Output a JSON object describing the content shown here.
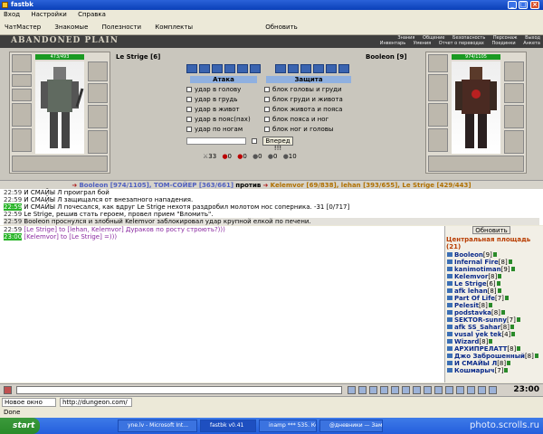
{
  "window": {
    "title": "fastbk",
    "minimize": "_",
    "maximize": "□",
    "close": "×"
  },
  "menu": [
    "Вход",
    "Настройки",
    "Справка"
  ],
  "toolbar": [
    "ЧатМастер",
    "Знакомые",
    "Полезности",
    "Комплекты",
    "Обновить"
  ],
  "game": {
    "logo": "ABANDONED PLAIN",
    "nav_row1": [
      "Знания",
      "Общение",
      "Безопасность",
      "Персонаж",
      "Выход"
    ],
    "nav_row2": [
      "Инвентарь",
      "Умения",
      "Отчет о переводах",
      "Поединки",
      "Анкета"
    ],
    "left_player": {
      "name": "Le Strige",
      "level": "[6]",
      "hp": "473/493"
    },
    "right_player": {
      "name": "Booleon",
      "level": "[9]",
      "hp": "974/1105"
    },
    "attack_header": "Атака",
    "defense_header": "Защита",
    "attack_options": [
      "удар в голову",
      "удар в грудь",
      "удар в живот",
      "удар в пояс(пах)",
      "удар по ногам"
    ],
    "defense_options": [
      "блок головы и груди",
      "блок груди и живота",
      "блок живота и пояса",
      "блок пояса и ног",
      "блок ног и головы"
    ],
    "forward_button": "Вперед !!!",
    "stat_icons": [
      "33",
      "0",
      "0",
      "0",
      "0",
      "10"
    ]
  },
  "vs_bar": {
    "team1": "Booleon [974/1105], ТОМ-СОЙЕР [363/661]",
    "vs": "против",
    "team2": "Kelemvor [69/838], lehan [393/655], Le Strige [429/443]"
  },
  "battle_log": [
    {
      "time": "22:59",
      "text": "И СМАЙЫ Л проиграл бой"
    },
    {
      "time": "22:59",
      "text": "И СМАЙЫ Л защищался от внезапного нападения."
    },
    {
      "time": "22:59",
      "text": "И СМАЙЫ Л почесался, как вдруг Le Strige нехотя раздробил молотом нос соперника. -31 [0/717]"
    },
    {
      "time": "22:59",
      "text": "Le Strige, решив стать героем, провел прием \"Вломить\"."
    },
    {
      "time": "22:59",
      "text": "Booleon проснулся и злобный Kelemvor заблокировал удар крупной елкой по печени."
    }
  ],
  "chat": [
    {
      "time": "22:59",
      "text": "[Le Strige] to [lehan, Kelemvor] Дураков по росту строють?)))"
    },
    {
      "time": "23:00",
      "text": "[Kelemvor] to [Le Strige] =)))"
    }
  ],
  "online": {
    "refresh": "Обновить",
    "location": "Центральная площадь",
    "count": "(21)",
    "users": [
      {
        "name": "Booleon",
        "level": "[9]"
      },
      {
        "name": "Infernal Fire",
        "level": "[8]"
      },
      {
        "name": "kanimotiman",
        "level": "[9]"
      },
      {
        "name": "Kelemvor",
        "level": "[8]"
      },
      {
        "name": "Le Strige",
        "level": "[6]"
      },
      {
        "name": "afk lehan",
        "level": "[8]"
      },
      {
        "name": "Part Of Life",
        "level": "[7]"
      },
      {
        "name": "Pelesit",
        "level": "[8]"
      },
      {
        "name": "podstavka",
        "level": "[8]"
      },
      {
        "name": "SEKTOR-sunny",
        "level": "[7]"
      },
      {
        "name": "afk SS_Sahar",
        "level": "[8]"
      },
      {
        "name": "vusal yek tek",
        "level": "[4]"
      },
      {
        "name": "Wizard",
        "level": "[8]"
      },
      {
        "name": "АРХИПРЕЛАТТ",
        "level": "[8]"
      },
      {
        "name": "Джо Заброшенный",
        "level": "[8]"
      },
      {
        "name": "И СМАЙЫ Л",
        "level": "[8]"
      },
      {
        "name": "Кошмарыч",
        "level": "[7]"
      }
    ]
  },
  "clock": "23:00",
  "status": {
    "new_window": "Новое окно",
    "url": "http://dungeon.com/",
    "done": "Done"
  },
  "taskbar": {
    "start": "start",
    "tasks": [
      "yne.lv - Microsoft Int...",
      "fastbk v0.41",
      "inamp *** 535. Кора...",
      "@дневники — Заме..."
    ],
    "watermark": "photo.scrolls.ru"
  }
}
